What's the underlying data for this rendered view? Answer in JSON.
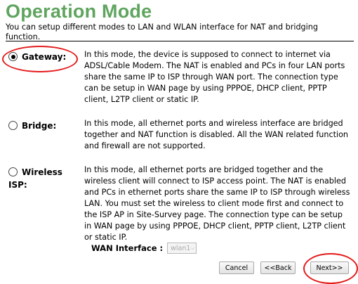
{
  "header": {
    "title": "Operation Mode",
    "description": "You can setup different modes to LAN and WLAN interface for NAT and bridging function."
  },
  "modes": [
    {
      "label": "Gateway:",
      "checked": true,
      "text": "In this mode, the device is supposed to connect to internet via ADSL/Cable Modem. The NAT is enabled and PCs in four LAN ports share the same IP to ISP through WAN port. The connection type can be setup in WAN page by using PPPOE, DHCP client, PPTP client, L2TP client or static IP."
    },
    {
      "label": "Bridge:",
      "checked": false,
      "text": "In this mode, all ethernet ports and wireless interface are bridged together and NAT function is disabled. All the WAN related function and firewall are not supported."
    },
    {
      "label": "Wireless ISP:",
      "checked": false,
      "text": "In this mode, all ethernet ports are bridged together and the wireless client will connect to ISP access point. The NAT is enabled and PCs in ethernet ports share the same IP to ISP through wireless LAN. You must set the wireless to client mode first and connect to the ISP AP in Site-Survey page. The connection type can be setup in WAN page by using PPPOE, DHCP client, PPTP client, L2TP client or static IP."
    }
  ],
  "wan_interface": {
    "label": "WAN Interface :",
    "value": "wlan1"
  },
  "buttons": {
    "cancel": "Cancel",
    "back": "<<Back",
    "next": "Next>>"
  },
  "colors": {
    "title": "#5fa55f",
    "annotation": "#e41b1b"
  }
}
